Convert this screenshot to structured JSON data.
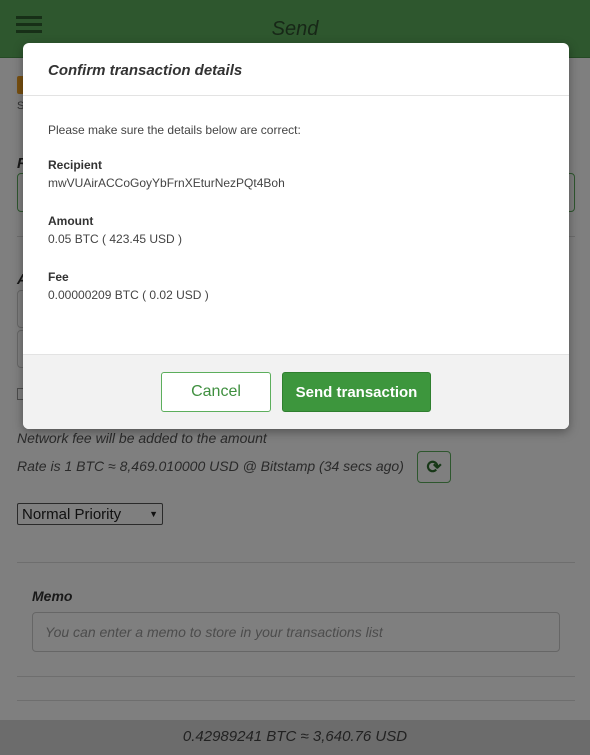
{
  "app": {
    "title": "Send",
    "priority": {
      "selected": "Normal Priority"
    },
    "fee_note": "Network fee will be added to the amount",
    "rate_text": "Rate is 1 BTC ≈ 8,469.010000 USD @ Bitstamp (34 secs ago)",
    "memo": {
      "label": "Memo",
      "placeholder": "You can enter a memo to store in your transactions list"
    },
    "balance": "0.42989241 BTC ≈ 3,640.76 USD"
  },
  "modal": {
    "title": "Confirm transaction details",
    "intro": "Please make sure the details below are correct:",
    "recipient": {
      "label": "Recipient",
      "value": "mwVUAirACCoGoyYbFrnXEturNezPQt4Boh"
    },
    "amount": {
      "label": "Amount",
      "value": "0.05 BTC ( 423.45 USD )"
    },
    "fee": {
      "label": "Fee",
      "value": "0.00000209 BTC ( 0.02 USD )"
    },
    "cancel_label": "Cancel",
    "send_label": "Send transaction"
  },
  "colors": {
    "accent": "#5cae5c",
    "button_primary": "#3d963d"
  },
  "icons": {
    "menu": "hamburger-icon",
    "refresh": "refresh-icon",
    "dropdown": "chevron-down-icon"
  }
}
